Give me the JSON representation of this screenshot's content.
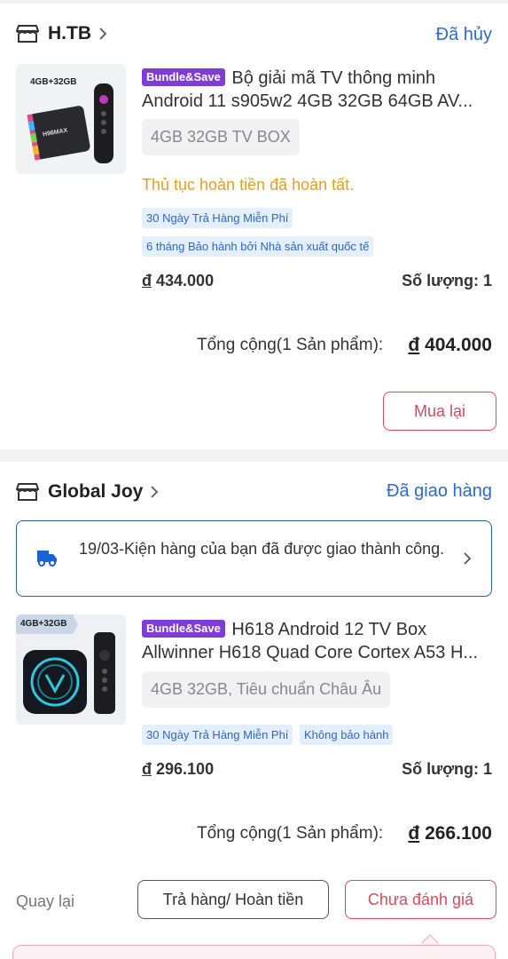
{
  "orders": [
    {
      "shop_name": "H.TB",
      "status": "Đã hủy",
      "product": {
        "badge": "Bundle&Save",
        "title_line1": "Bộ giải mã TV thông minh",
        "title_line2": "Android 11 s905w2 4GB 32GB 64GB AV...",
        "thumb_label": "4GB+32GB",
        "thumb_brand": "H96MAX",
        "variant": "4GB 32GB TV BOX",
        "refund_note": "Thủ tục hoàn tiền đã hoàn tất.",
        "tags": [
          "30 Ngày Trả Hàng Miễn Phí",
          "6 tháng Bảo hành bởi Nhà sản xuất quốc tế"
        ],
        "currency": "đ",
        "price": "434.000",
        "quantity": "Số lượng: 1"
      },
      "total_label": "Tổng cộng(1 Sản phẩm):",
      "total_currency": "đ",
      "total_value": "404.000",
      "buttons": {
        "rebuy": "Mua lại"
      }
    },
    {
      "shop_name": "Global Joy",
      "status": "Đã giao hàng",
      "delivery_notice": "19/03-Kiện hàng của bạn đã được giao thành công.",
      "product": {
        "badge": "Bundle&Save",
        "title_line1": "H618 Android 12 TV Box",
        "title_line2": "Allwinner H618 Quad Core Cortex A53 H...",
        "thumb_label": "4GB+32GB",
        "variant": "4GB 32GB, Tiêu chuẩn Châu Âu",
        "tags": [
          "30 Ngày Trả Hàng Miễn Phí",
          "Không bảo hành"
        ],
        "currency": "đ",
        "price": "296.100",
        "quantity": "Số lượng: 1"
      },
      "total_label": "Tổng cộng(1 Sản phẩm):",
      "total_currency": "đ",
      "total_value": "266.100",
      "buttons": {
        "back": "Quay lại",
        "return_refund": "Trả hàng/ Hoàn tiền",
        "not_rated": "Chưa đánh giá"
      }
    }
  ],
  "colors": {
    "status_blue": "#2e6bc6",
    "accent_red": "#d64a5e",
    "badge_purple": "#7f3cd6",
    "refund_orange": "#e0a02a",
    "tag_bg": "#e3effd"
  },
  "icons": {
    "shop": "store-icon",
    "chevron": "chevron-right-icon",
    "delivery": "delivery-truck-icon"
  }
}
